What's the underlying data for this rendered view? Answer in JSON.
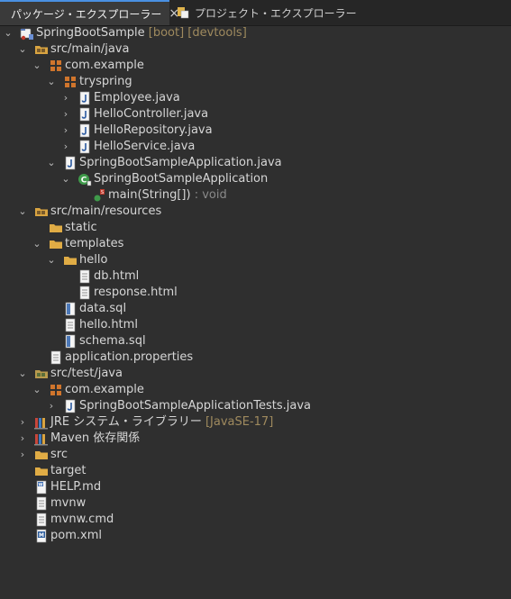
{
  "tabs": {
    "active_label": "パッケージ・エクスプローラー",
    "close_glyph": "×",
    "inactive_label": "プロジェクト・エクスプローラー"
  },
  "tree": [
    {
      "label": "SpringBootSample",
      "decoration": "[boot] [devtools]",
      "icon": "java-project-icon",
      "expanded": true
    },
    {
      "label": "src/main/java",
      "icon": "source-folder-icon",
      "expanded": true
    },
    {
      "label": "com.example",
      "icon": "package-icon",
      "expanded": true
    },
    {
      "label": "tryspring",
      "icon": "package-icon",
      "expanded": true
    },
    {
      "label": "Employee.java",
      "icon": "java-file-icon",
      "expanded": false
    },
    {
      "label": "HelloController.java",
      "icon": "java-file-icon",
      "expanded": false
    },
    {
      "label": "HelloRepository.java",
      "icon": "java-file-icon",
      "expanded": false
    },
    {
      "label": "HelloService.java",
      "icon": "java-file-icon",
      "expanded": false
    },
    {
      "label": "SpringBootSampleApplication.java",
      "icon": "java-file-icon",
      "expanded": true
    },
    {
      "label": "SpringBootSampleApplication",
      "icon": "class-icon",
      "expanded": true
    },
    {
      "label": "main(String[])",
      "decoration": ": void",
      "icon": "method-icon"
    },
    {
      "label": "src/main/resources",
      "icon": "source-folder-icon",
      "expanded": true
    },
    {
      "label": "static",
      "icon": "folder-icon"
    },
    {
      "label": "templates",
      "icon": "folder-icon",
      "expanded": true
    },
    {
      "label": "hello",
      "icon": "folder-icon",
      "expanded": true
    },
    {
      "label": "db.html",
      "icon": "file-icon"
    },
    {
      "label": "response.html",
      "icon": "file-icon"
    },
    {
      "label": "data.sql",
      "icon": "sql-file-icon"
    },
    {
      "label": "hello.html",
      "icon": "file-icon"
    },
    {
      "label": "schema.sql",
      "icon": "sql-file-icon"
    },
    {
      "label": "application.properties",
      "icon": "file-icon"
    },
    {
      "label": "src/test/java",
      "icon": "source-folder-icon",
      "expanded": true
    },
    {
      "label": "com.example",
      "icon": "package-icon",
      "expanded": true
    },
    {
      "label": "SpringBootSampleApplicationTests.java",
      "icon": "java-file-icon",
      "expanded": false
    },
    {
      "label": "JRE システム・ライブラリー",
      "decoration": "[JavaSE-17]",
      "icon": "library-icon",
      "expanded": false
    },
    {
      "label": "Maven 依存関係",
      "icon": "library-icon",
      "expanded": false
    },
    {
      "label": "src",
      "icon": "folder-icon",
      "expanded": false
    },
    {
      "label": "target",
      "icon": "folder-icon"
    },
    {
      "label": "HELP.md",
      "icon": "markdown-file-icon"
    },
    {
      "label": "mvnw",
      "icon": "file-icon"
    },
    {
      "label": "mvnw.cmd",
      "icon": "file-icon"
    },
    {
      "label": "pom.xml",
      "icon": "maven-pom-icon"
    }
  ]
}
